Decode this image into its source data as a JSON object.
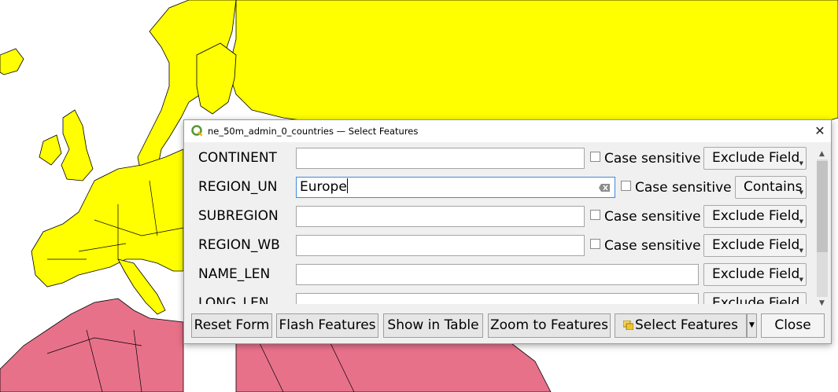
{
  "window": {
    "title": "ne_50m_admin_0_countries — Select Features"
  },
  "colors": {
    "land_yellow": "#ffff00",
    "land_pink": "#e8718a",
    "sea": "#ffffff",
    "border": "#000000"
  },
  "icons": {
    "app": "qgis-icon",
    "close": "close-icon",
    "clear": "clear-text-icon",
    "select": "select-features-icon"
  },
  "fields": [
    {
      "label": "CONTINENT",
      "value": "",
      "case_sensitive_label": "Case sensitive",
      "operator": "Exclude Field"
    },
    {
      "label": "REGION_UN",
      "value": "Europe",
      "case_sensitive_label": "Case sensitive",
      "operator": "Contains"
    },
    {
      "label": "SUBREGION",
      "value": "",
      "case_sensitive_label": "Case sensitive",
      "operator": "Exclude Field"
    },
    {
      "label": "REGION_WB",
      "value": "",
      "case_sensitive_label": "Case sensitive",
      "operator": "Exclude Field"
    },
    {
      "label": "NAME_LEN",
      "value": "",
      "operator": "Exclude Field"
    },
    {
      "label": "LONG_LEN",
      "value": "",
      "operator": "Exclude Field"
    }
  ],
  "buttons": {
    "reset": "Reset Form",
    "flash": "Flash Features",
    "show_table": "Show in Table",
    "zoom": "Zoom to Features",
    "select": "Select Features",
    "close": "Close"
  }
}
